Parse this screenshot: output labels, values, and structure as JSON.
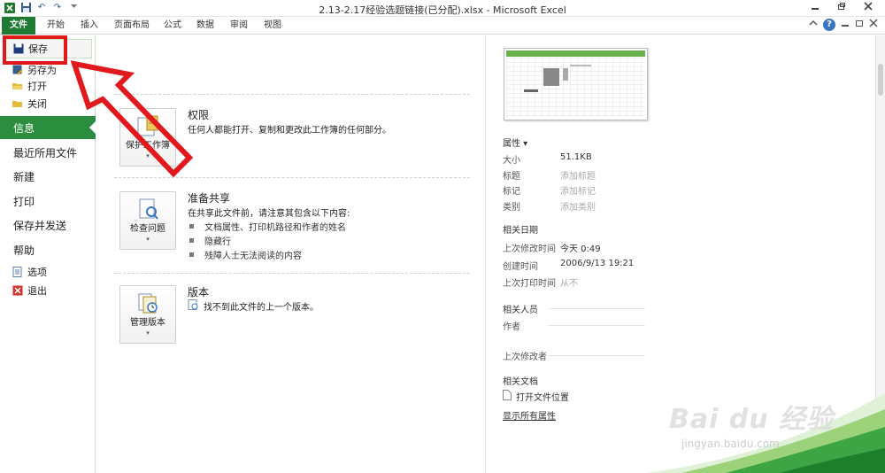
{
  "window": {
    "title": "2.13-2.17经验选题链接(已分配).xlsx - Microsoft Excel"
  },
  "qat": {
    "undo_glyph": "↶",
    "redo_glyph": "↷"
  },
  "tabs": [
    {
      "label": "文件"
    },
    {
      "label": "开始"
    },
    {
      "label": "插入"
    },
    {
      "label": "页面布局"
    },
    {
      "label": "公式"
    },
    {
      "label": "数据"
    },
    {
      "label": "审阅"
    },
    {
      "label": "视图"
    }
  ],
  "nav": {
    "save": "保存",
    "save_as": "另存为",
    "open": "打开",
    "close": "关闭",
    "info": "信息",
    "recent": "最近所用文件",
    "new": "新建",
    "print": "打印",
    "save_send": "保存并发送",
    "help": "帮助",
    "options": "选项",
    "exit": "退出"
  },
  "permissions": {
    "button": "保护工作簿",
    "title": "权限",
    "desc": "任何人都能打开、复制和更改此工作簿的任何部分。"
  },
  "prepare": {
    "button": "检查问题",
    "title": "准备共享",
    "desc": "在共享此文件前，请注意其包含以下内容:",
    "bullets": [
      "文档属性、打印机路径和作者的姓名",
      "隐藏行",
      "残障人士无法阅读的内容"
    ]
  },
  "versions": {
    "button": "管理版本",
    "title": "版本",
    "desc": "找不到此文件的上一个版本。"
  },
  "properties": {
    "header": "属性 ▾",
    "rows": [
      {
        "label": "大小",
        "value": "51.1KB"
      },
      {
        "label": "标题",
        "value": "添加标题"
      },
      {
        "label": "标记",
        "value": "添加标记"
      },
      {
        "label": "类别",
        "value": "添加类别"
      }
    ],
    "dates_header": "相关日期",
    "dates": [
      {
        "label": "上次修改时间",
        "value": "今天 0:49"
      },
      {
        "label": "创建时间",
        "value": "2006/9/13 19:21"
      },
      {
        "label": "上次打印时间",
        "value": "从不"
      }
    ],
    "people_header": "相关人员",
    "author_label": "作者",
    "last_modified_by_label": "上次修改者",
    "docs_header": "相关文档",
    "open_location": "打开文件位置",
    "show_all": "显示所有属性"
  },
  "watermark": {
    "brand": "Bai du 经验",
    "url": "jingyan.baidu.com"
  },
  "colors": {
    "file_tab": "#1e7a33",
    "info_selected": "#2b8e3e",
    "annotation": "#e1181c"
  }
}
